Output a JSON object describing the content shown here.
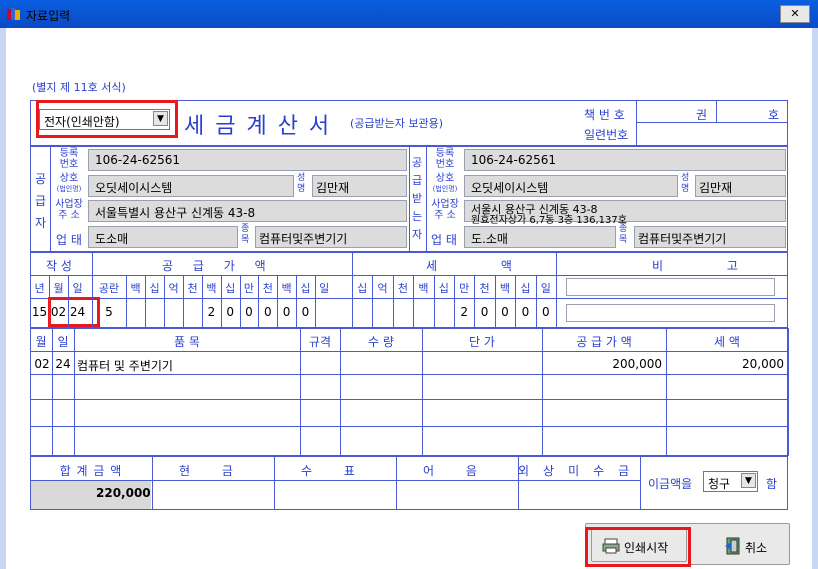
{
  "window": {
    "title": "자료입력",
    "close": "✕"
  },
  "form": {
    "note": "(별지 제 11호 서식)",
    "type_select": "전자(인쇄안함)",
    "title": "세 금 계 산 서",
    "subtitle": "(공급받는자 보관용)",
    "book_label": "책 번 호",
    "serial_label": "일련번호",
    "gwon": "권",
    "ho": "호"
  },
  "supplier": {
    "side_label": [
      "공",
      "급",
      "자"
    ],
    "reg_label": [
      "등록",
      "번호"
    ],
    "reg": "106-24-62561",
    "name_label": [
      "상호",
      "(법인명)"
    ],
    "name": "오딧세이시스템",
    "rep_label": [
      "성",
      "명"
    ],
    "rep": "김만재",
    "addr_label": [
      "사업장",
      "주 소"
    ],
    "addr": "서울특별시 용산구 신계동 43-8",
    "biz_label": "업 태",
    "biz": "도소매",
    "item_label": [
      "종",
      "목"
    ],
    "item": "컴퓨터및주변기기"
  },
  "buyer": {
    "side_label": [
      "공",
      "급",
      "받",
      "는",
      "자"
    ],
    "reg_label": [
      "등록",
      "번호"
    ],
    "reg": "106-24-62561",
    "name_label": [
      "상호",
      "(법인명)"
    ],
    "name": "오딧세이시스템",
    "rep_label": [
      "성",
      "명"
    ],
    "rep": "김만재",
    "addr_label": [
      "사업장",
      "주 소"
    ],
    "addr1": "서울시 용산구 신계동 43-8",
    "addr2": "원효전자상가 6,7동 3층 136,137호",
    "biz_label": "업 태",
    "biz": "도.소매",
    "item_label": [
      "종",
      "목"
    ],
    "item": "컴퓨터및주변기기"
  },
  "amount": {
    "h_write": "작 성",
    "h_supply": "공 급 가 액",
    "h_tax": "세 액",
    "h_note": "비 고",
    "date_cols": [
      "년",
      "월",
      "일"
    ],
    "blank_label": "공란",
    "supply_digits": [
      "백",
      "십",
      "억",
      "천",
      "백",
      "십",
      "만",
      "천",
      "백",
      "십",
      "일"
    ],
    "tax_digits": [
      "십",
      "억",
      "천",
      "백",
      "십",
      "만",
      "천",
      "백",
      "십",
      "일"
    ],
    "year": "15",
    "month": "02",
    "day": "24",
    "blank": "5",
    "supply_values": [
      "",
      "",
      "",
      "",
      "2",
      "0",
      "0",
      "0",
      "0",
      "0",
      ""
    ],
    "supply_vals": [
      "",
      "",
      "",
      "",
      "2",
      "0",
      "0",
      "0",
      "0",
      "0"
    ],
    "tax_vals": [
      "",
      "",
      "",
      "",
      "",
      "2",
      "0",
      "0",
      "0",
      "0"
    ]
  },
  "items": {
    "headers": [
      "월",
      "일",
      "품 목",
      "규격",
      "수 량",
      "단 가",
      "공 급 가 액",
      "세 액"
    ],
    "rows": [
      {
        "m": "02",
        "d": "24",
        "name": "컴퓨터 및 주변기기",
        "supply": "200,000",
        "tax": "20,000"
      }
    ]
  },
  "totals": {
    "headers": [
      "합 계 금 액",
      "현 금",
      "수 표",
      "어 음",
      "외상미수금"
    ],
    "total": "220,000",
    "claim_prefix": "이금액을",
    "claim_select": "청구",
    "claim_suffix": "함"
  },
  "buttons": {
    "print": "인쇄시작",
    "cancel": "취소"
  }
}
